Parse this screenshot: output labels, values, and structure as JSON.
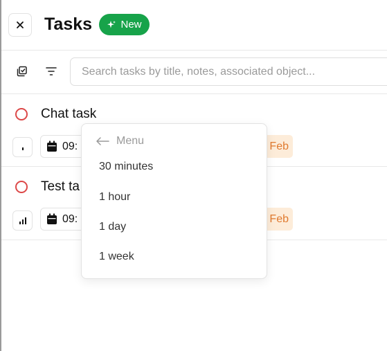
{
  "header": {
    "title": "Tasks",
    "new_badge": "New",
    "close_icon": "close-icon"
  },
  "toolbar": {
    "search_placeholder": "Search tasks by title, notes, associated object..."
  },
  "tasks": [
    {
      "title": "Chat task",
      "time": "09:",
      "date_suffix": "Feb"
    },
    {
      "title": "Test ta",
      "time": "09:",
      "date_suffix": "Feb"
    }
  ],
  "menu": {
    "back_label": "Menu",
    "items": [
      "30 minutes",
      "1 hour",
      "1 day",
      "1 week"
    ]
  },
  "colors": {
    "accent_green": "#17a34a",
    "task_circle": "#dc4848",
    "date_chip_bg": "#fdecd9",
    "date_chip_text": "#e07a2f"
  }
}
